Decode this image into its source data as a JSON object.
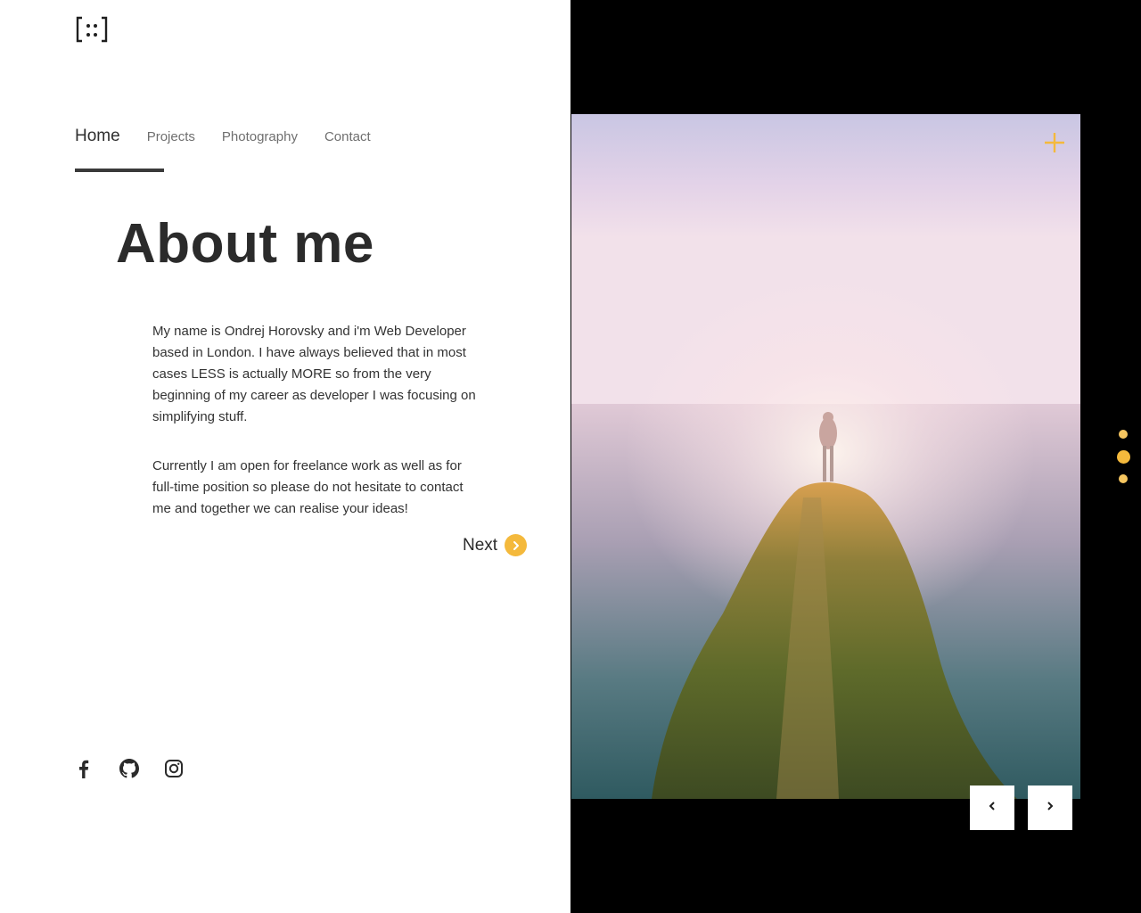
{
  "logo": {
    "icon": "bracket-dots-logo-icon"
  },
  "nav": {
    "items": [
      {
        "label": "Home",
        "active": true
      },
      {
        "label": "Projects",
        "active": false
      },
      {
        "label": "Photography",
        "active": false
      },
      {
        "label": "Contact",
        "active": false
      }
    ]
  },
  "main": {
    "title": "About me",
    "paragraph1": "My name is Ondrej Horovsky and i'm Web Developer based in London. I have always believed that in most cases LESS is actually MORE so from the very beginning of my career as developer I was focusing on simplifying stuff.",
    "paragraph2": "Currently I am open for freelance work as well as for full-time position so please do not hesitate to contact me and together we can realise your ideas!",
    "next_label": "Next"
  },
  "social": [
    {
      "icon": "facebook-icon"
    },
    {
      "icon": "github-icon"
    },
    {
      "icon": "instagram-icon"
    }
  ],
  "slider": {
    "slide_count": 3,
    "active_slide": 2,
    "prev_icon": "chevron-left-icon",
    "next_icon": "chevron-right-icon",
    "expand_icon": "plus-icon"
  },
  "colors": {
    "accent": "#f4b93c",
    "text": "#2b2b2b",
    "muted": "#6f6f6f",
    "right_panel": "#000000"
  }
}
